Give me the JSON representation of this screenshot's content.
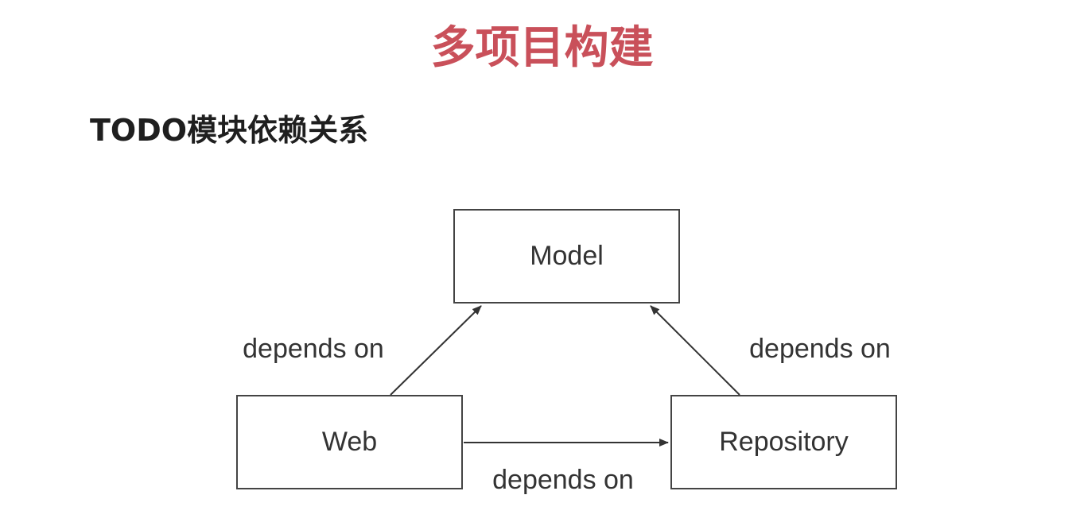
{
  "slide": {
    "title": "多项目构建",
    "subtitle": "TODO模块依赖关系"
  },
  "diagram": {
    "nodes": {
      "model": "Model",
      "web": "Web",
      "repository": "Repository"
    },
    "edges": {
      "web_to_model": "depends on",
      "repository_to_model": "depends on",
      "web_to_repository": "depends on"
    }
  }
}
